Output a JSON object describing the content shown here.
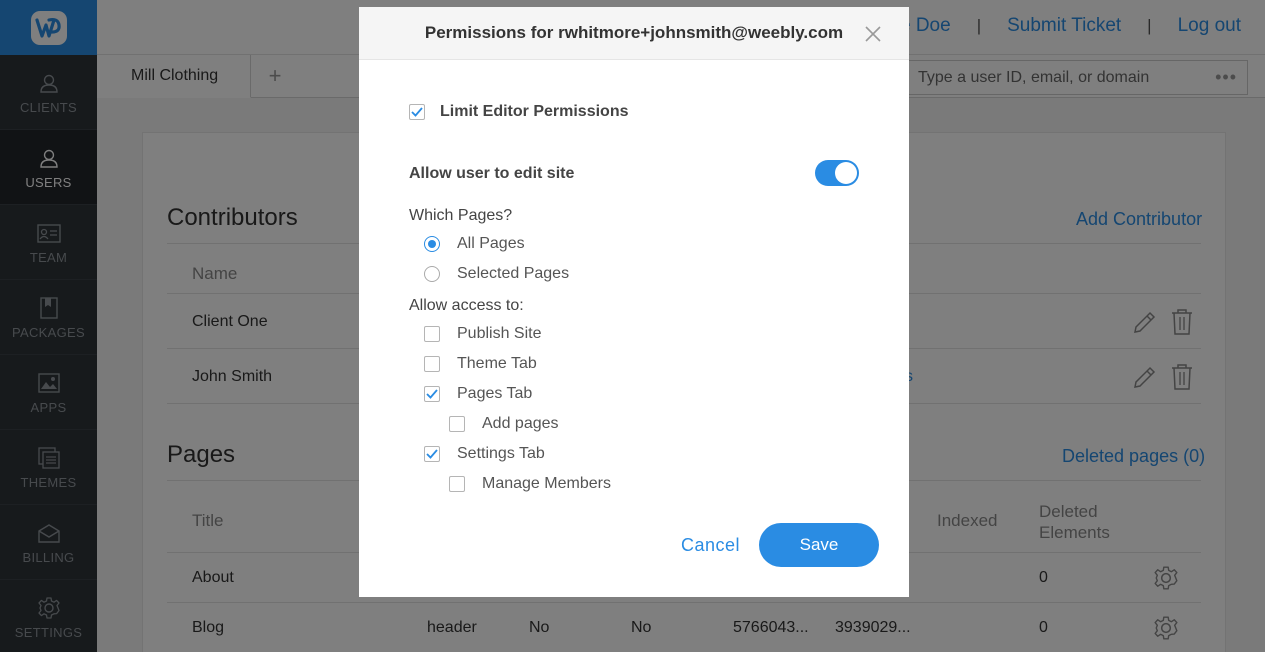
{
  "sidebar": {
    "logo_icon": "weebly-logo-icon",
    "items": [
      {
        "label": "CLIENTS",
        "icon": "user-icon"
      },
      {
        "label": "USERS",
        "icon": "user-icon"
      },
      {
        "label": "TEAM",
        "icon": "id-card-icon"
      },
      {
        "label": "PACKAGES",
        "icon": "package-icon"
      },
      {
        "label": "APPS",
        "icon": "image-icon"
      },
      {
        "label": "THEMES",
        "icon": "layers-icon"
      },
      {
        "label": "BILLING",
        "icon": "envelope-icon"
      },
      {
        "label": "SETTINGS",
        "icon": "gear-icon"
      }
    ],
    "active": "USERS"
  },
  "header": {
    "user_name": "Jane Doe",
    "submit_ticket": "Submit Ticket",
    "logout": "Log out",
    "separator": "|"
  },
  "tabs": {
    "site_tab": "Mill Clothing",
    "add_tab": "+",
    "search_placeholder": "Type a user ID, email, or domain",
    "more": "•••"
  },
  "contributors": {
    "title": "Contributors",
    "action": "Add Contributor",
    "column_name": "Name",
    "rows": [
      {
        "name": "Client One",
        "extra": ""
      },
      {
        "name": "John Smith",
        "extra": "s"
      }
    ]
  },
  "pages": {
    "title": "Pages",
    "action": "Deleted pages (0)",
    "columns": {
      "title": "Title",
      "indexed": "Indexed",
      "deleted": "Deleted Elements"
    },
    "rows": [
      {
        "title": "About",
        "layout": "",
        "c3": "",
        "c4": "",
        "c5": "",
        "c6": "",
        "deleted": "0"
      },
      {
        "title": "Blog",
        "layout": "header",
        "c3": "No",
        "c4": "No",
        "c5": "5766043...",
        "c6": "3939029...",
        "deleted": "0"
      }
    ]
  },
  "modal": {
    "title": "Permissions for rwhitmore+johnsmith@weebly.com",
    "limit_label": "Limit Editor Permissions",
    "limit_checked": true,
    "allow_edit_label": "Allow user to edit site",
    "allow_edit_on": true,
    "which_pages_label": "Which Pages?",
    "page_options": [
      {
        "label": "All Pages",
        "selected": true
      },
      {
        "label": "Selected Pages",
        "selected": false
      }
    ],
    "allow_access_label": "Allow access to:",
    "access": [
      {
        "label": "Publish Site",
        "checked": false
      },
      {
        "label": "Theme Tab",
        "checked": false
      },
      {
        "label": "Pages Tab",
        "checked": true
      },
      {
        "label": "Add pages",
        "checked": false
      },
      {
        "label": "Settings Tab",
        "checked": true
      },
      {
        "label": "Manage Members",
        "checked": false
      }
    ],
    "cancel": "Cancel",
    "save": "Save"
  },
  "colors": {
    "accent": "#2a8ce3",
    "sidebar_bg": "#2f3439",
    "sidebar_active": "#23272b"
  }
}
